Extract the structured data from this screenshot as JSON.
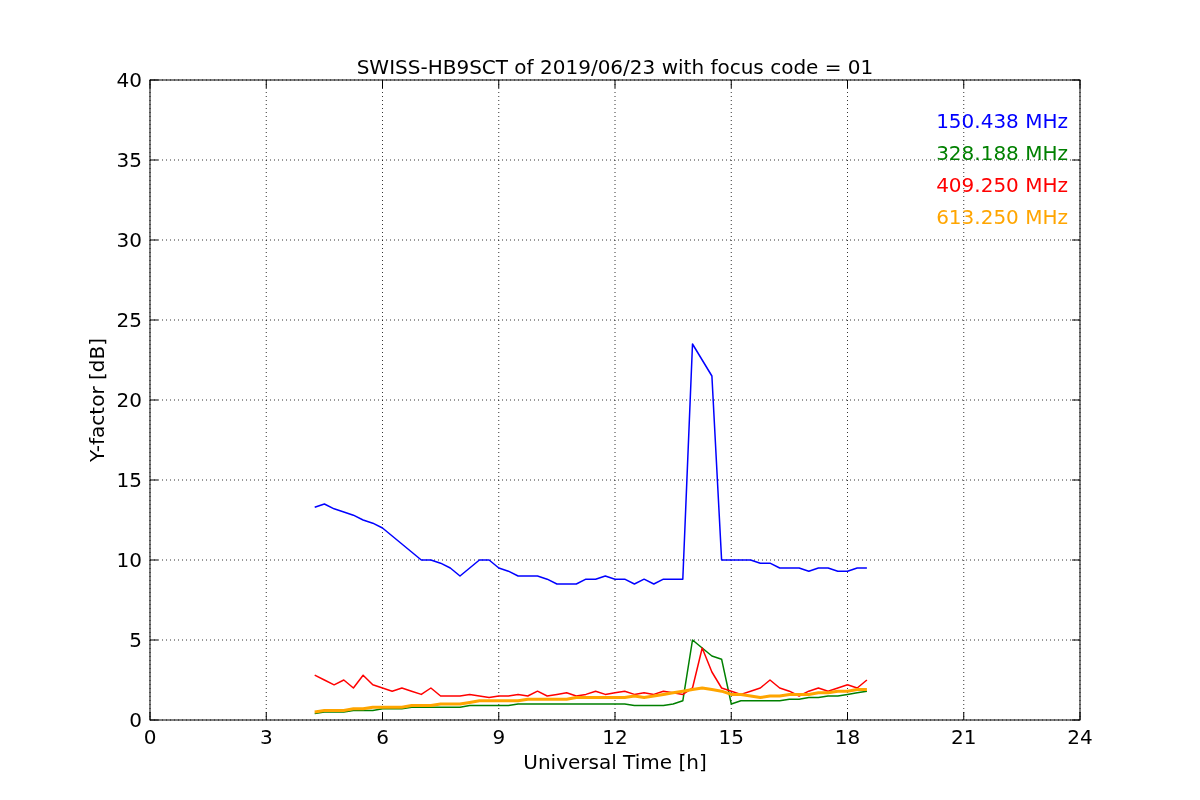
{
  "chart_data": {
    "type": "line",
    "title": "SWISS-HB9SCT of 2019/06/23 with focus code = 01",
    "xlabel": "Universal Time [h]",
    "ylabel": "Y-factor [dB]",
    "x": [
      4.25,
      4.5,
      4.75,
      5,
      5.25,
      5.5,
      5.75,
      6,
      6.25,
      6.5,
      6.75,
      7,
      7.25,
      7.5,
      7.75,
      8,
      8.25,
      8.5,
      8.75,
      9,
      9.25,
      9.5,
      9.75,
      10,
      10.25,
      10.5,
      10.75,
      11,
      11.25,
      11.5,
      11.75,
      12,
      12.25,
      12.5,
      12.75,
      13,
      13.25,
      13.5,
      13.75,
      14,
      14.25,
      14.5,
      14.75,
      15,
      15.25,
      15.5,
      15.75,
      16,
      16.25,
      16.5,
      16.75,
      17,
      17.25,
      17.5,
      17.75,
      18,
      18.25,
      18.5
    ],
    "series": [
      {
        "name": "150.438 MHz",
        "color": "#0000ff",
        "values": [
          13.3,
          13.5,
          13.2,
          13,
          12.8,
          12.5,
          12.3,
          12,
          11.5,
          11,
          10.5,
          10,
          10,
          9.8,
          9.5,
          9,
          9.5,
          10,
          10,
          9.5,
          9.3,
          9,
          9,
          9,
          8.8,
          8.5,
          8.5,
          8.5,
          8.8,
          8.8,
          9,
          8.8,
          8.8,
          8.5,
          8.8,
          8.5,
          8.8,
          8.8,
          8.8,
          23.5,
          22.5,
          21.5,
          10,
          10,
          10,
          10,
          9.8,
          9.8,
          9.5,
          9.5,
          9.5,
          9.3,
          9.5,
          9.5,
          9.3,
          9.3,
          9.5,
          9.5
        ]
      },
      {
        "name": "328.188 MHz",
        "color": "#008000",
        "values": [
          0.4,
          0.5,
          0.5,
          0.5,
          0.6,
          0.6,
          0.6,
          0.7,
          0.7,
          0.7,
          0.8,
          0.8,
          0.8,
          0.8,
          0.8,
          0.8,
          0.9,
          0.9,
          0.9,
          0.9,
          0.9,
          1,
          1,
          1,
          1,
          1,
          1,
          1,
          1,
          1,
          1,
          1,
          1,
          0.9,
          0.9,
          0.9,
          0.9,
          1,
          1.2,
          5,
          4.5,
          4,
          3.8,
          1,
          1.2,
          1.2,
          1.2,
          1.2,
          1.2,
          1.3,
          1.3,
          1.4,
          1.4,
          1.5,
          1.5,
          1.6,
          1.7,
          1.8
        ]
      },
      {
        "name": "409.250 MHz",
        "color": "#ff0000",
        "values": [
          2.8,
          2.5,
          2.2,
          2.5,
          2,
          2.8,
          2.2,
          2,
          1.8,
          2,
          1.8,
          1.6,
          2,
          1.5,
          1.5,
          1.5,
          1.6,
          1.5,
          1.4,
          1.5,
          1.5,
          1.6,
          1.5,
          1.8,
          1.5,
          1.6,
          1.7,
          1.5,
          1.6,
          1.8,
          1.6,
          1.7,
          1.8,
          1.6,
          1.7,
          1.6,
          1.8,
          1.7,
          1.6,
          2,
          4.5,
          3,
          2,
          1.8,
          1.6,
          1.8,
          2,
          2.5,
          2,
          1.8,
          1.5,
          1.8,
          2,
          1.8,
          2,
          2.2,
          2,
          2.5
        ]
      },
      {
        "name": "613.250 MHz",
        "color": "#ffa500",
        "values": [
          0.5,
          0.6,
          0.6,
          0.6,
          0.7,
          0.7,
          0.8,
          0.8,
          0.8,
          0.8,
          0.9,
          0.9,
          0.9,
          1,
          1,
          1,
          1.1,
          1.2,
          1.2,
          1.2,
          1.2,
          1.2,
          1.3,
          1.3,
          1.3,
          1.3,
          1.3,
          1.4,
          1.4,
          1.4,
          1.4,
          1.4,
          1.4,
          1.5,
          1.4,
          1.5,
          1.6,
          1.7,
          1.8,
          1.9,
          2,
          1.9,
          1.8,
          1.6,
          1.6,
          1.5,
          1.4,
          1.5,
          1.5,
          1.6,
          1.6,
          1.6,
          1.7,
          1.7,
          1.8,
          1.8,
          1.9,
          1.9
        ]
      }
    ],
    "grid": true,
    "xlim": [
      0,
      24
    ],
    "ylim": [
      0,
      40
    ],
    "xticks": [
      0,
      3,
      6,
      9,
      12,
      15,
      18,
      21,
      24
    ],
    "yticks": [
      0,
      5,
      10,
      15,
      20,
      25,
      30,
      35,
      40
    ]
  }
}
